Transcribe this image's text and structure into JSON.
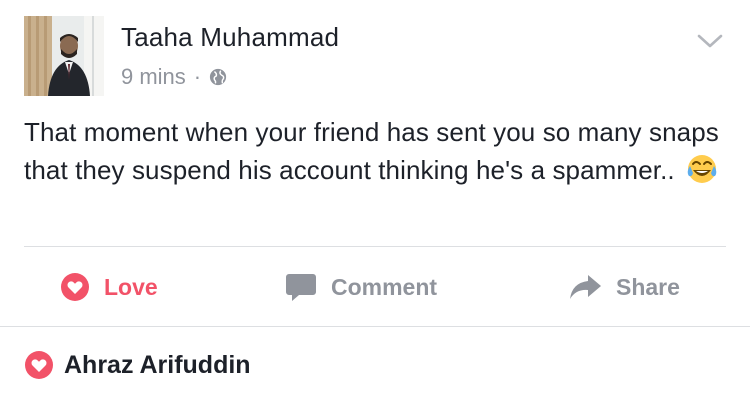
{
  "post": {
    "author": "Taaha Muhammad",
    "time": "9 mins",
    "separator": "·",
    "privacy_icon": "globe-icon",
    "text": "That moment when your friend has sent you so many snaps that they suspend his account thinking he's a spammer..",
    "emoji": "face-with-tears-of-joy"
  },
  "actions": {
    "love_label": "Love",
    "comment_label": "Comment",
    "share_label": "Share"
  },
  "reactions": {
    "reactor_name": "Ahraz Arifuddin"
  },
  "colors": {
    "love": "#f25268",
    "muted": "#90949c",
    "text": "#1d2129",
    "divider": "#dddfe2"
  }
}
